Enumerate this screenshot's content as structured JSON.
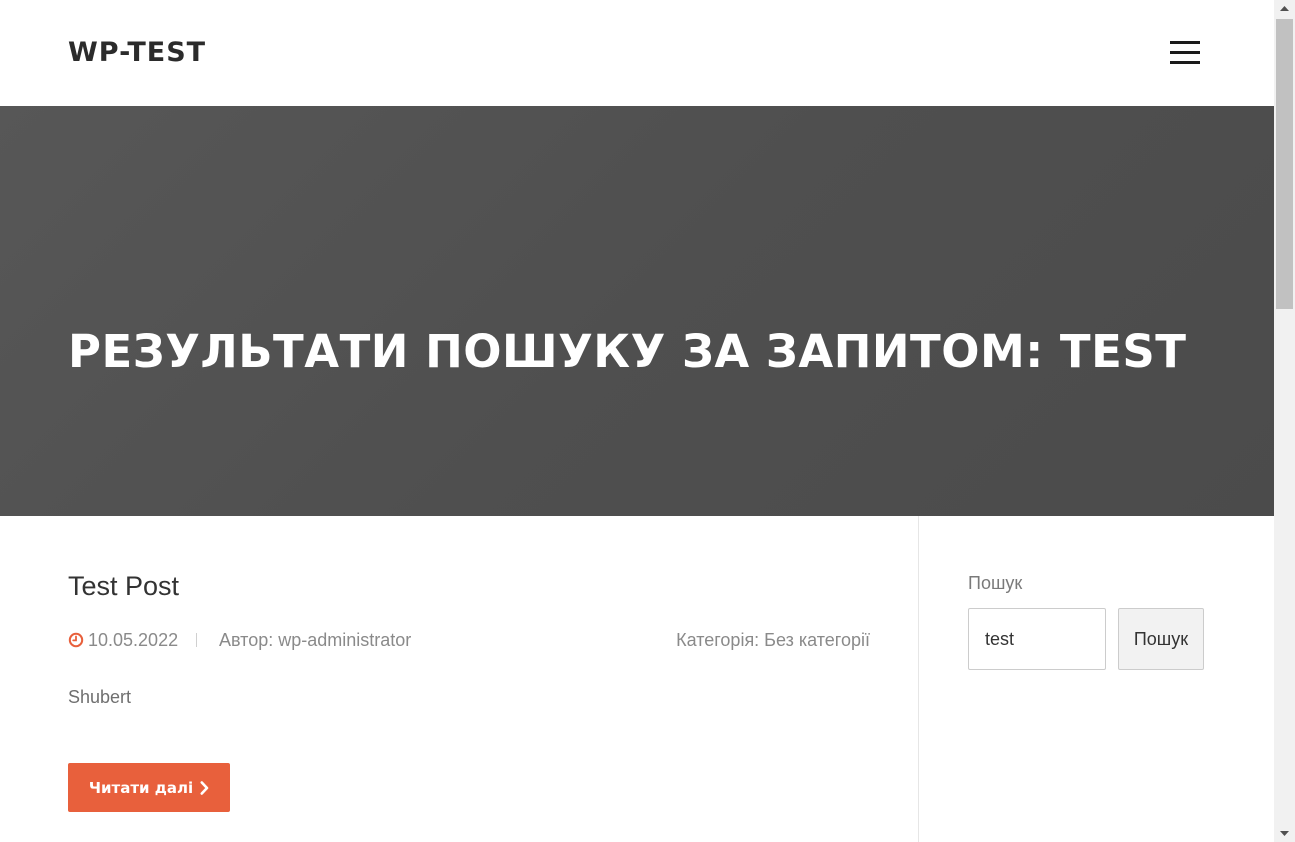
{
  "header": {
    "site_title": "WP-TEST",
    "menu_icon": "hamburger-menu-icon"
  },
  "hero": {
    "title": "РЕЗУЛЬТАТИ ПОШУКУ ЗА ЗАПИТОМ: TEST"
  },
  "post": {
    "title": "Test Post",
    "date": "10.05.2022",
    "date_icon": "clock-icon",
    "author": "Автор: wp-administrator",
    "category": "Категорія: Без категорії",
    "excerpt": "Shubert",
    "read_more_label": "Читати далі",
    "read_more_icon": "chevron-right-icon"
  },
  "sidebar": {
    "search_widget_title": "Пошук",
    "search_value": "test",
    "search_button_label": "Пошук"
  },
  "colors": {
    "accent": "#e8603c",
    "hero_background": "#505050",
    "text_dark": "#333333",
    "text_muted": "#8a8a8a"
  }
}
